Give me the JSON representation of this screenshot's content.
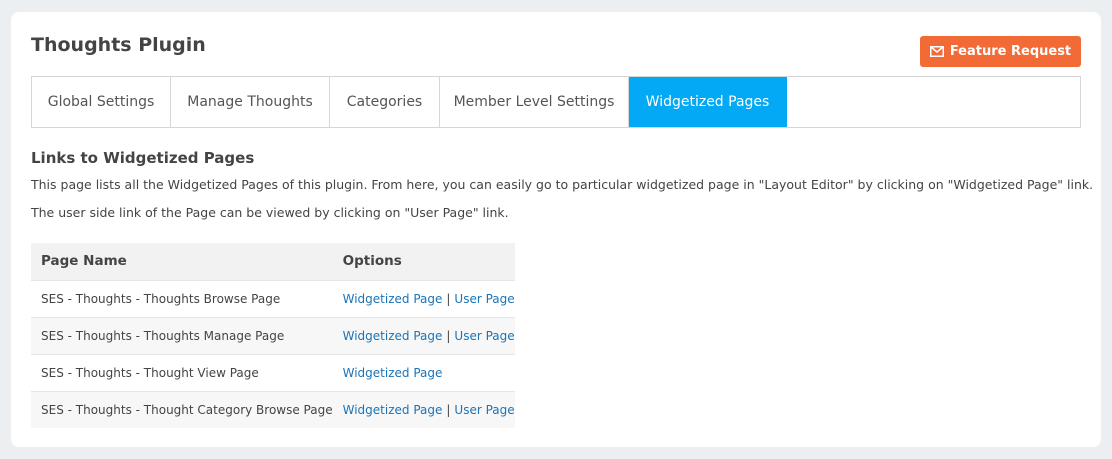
{
  "header": {
    "title": "Thoughts Plugin",
    "feature_button": "Feature Request",
    "feature_icon": "envelope-icon",
    "accent_color": "#f26b36"
  },
  "tabs": [
    {
      "label": "Global Settings",
      "active": false
    },
    {
      "label": "Manage Thoughts",
      "active": false
    },
    {
      "label": "Categories",
      "active": false
    },
    {
      "label": "Member Level Settings",
      "active": false
    },
    {
      "label": "Widgetized Pages",
      "active": true
    }
  ],
  "active_tab_color": "#03a9f4",
  "section": {
    "title": "Links to Widgetized Pages",
    "description_1": "This page lists all the Widgetized Pages of this plugin. From here, you can easily go to particular widgetized page in \"Layout Editor\" by clicking on \"Widgetized Page\" link.",
    "description_2": "The user side link of the Page can be viewed by clicking on \"User Page\" link."
  },
  "table": {
    "headers": [
      "Page Name",
      "Options"
    ],
    "rows": [
      {
        "name": "SES - Thoughts - Thoughts Browse Page",
        "widgetized": "Widgetized Page",
        "separator": "|",
        "user": "User Page"
      },
      {
        "name": "SES - Thoughts - Thoughts Manage Page",
        "widgetized": "Widgetized Page",
        "separator": "|",
        "user": "User Page"
      },
      {
        "name": "SES - Thoughts - Thought View Page",
        "widgetized": "Widgetized Page"
      },
      {
        "name": "SES - Thoughts - Thought Category Browse Page",
        "widgetized": "Widgetized Page",
        "separator": "|",
        "user": "User Page"
      }
    ]
  }
}
